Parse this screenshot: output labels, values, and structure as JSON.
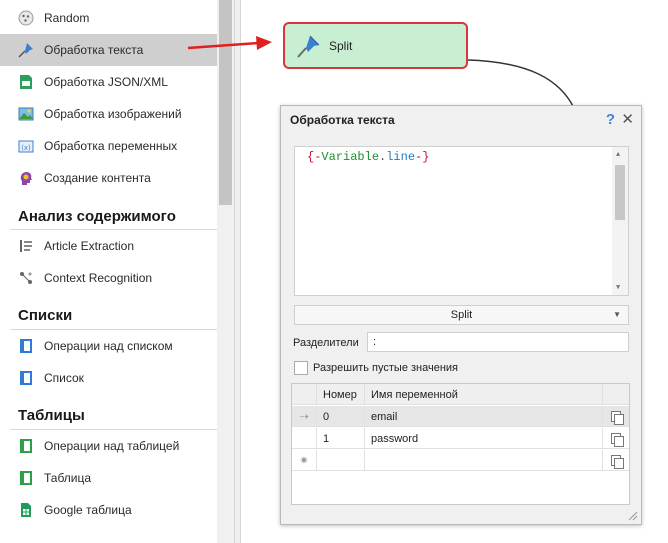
{
  "sidebar": {
    "items": [
      {
        "label": "Random",
        "icon": "dice-icon"
      },
      {
        "label": "Обработка текста",
        "icon": "pin-icon",
        "selected": true
      },
      {
        "label": "Обработка JSON/XML",
        "icon": "json-file-icon"
      },
      {
        "label": "Обработка изображений",
        "icon": "image-icon"
      },
      {
        "label": "Обработка переменных",
        "icon": "variable-icon"
      },
      {
        "label": "Создание контента",
        "icon": "head-bulb-icon"
      }
    ],
    "sections": [
      {
        "title": "Анализ содержимого",
        "items": [
          {
            "label": "Article Extraction",
            "icon": "article-icon"
          },
          {
            "label": "Context Recognition",
            "icon": "context-icon"
          }
        ]
      },
      {
        "title": "Списки",
        "items": [
          {
            "label": "Операции над списком",
            "icon": "list-ops-icon"
          },
          {
            "label": "Список",
            "icon": "list-icon"
          }
        ]
      },
      {
        "title": "Таблицы",
        "items": [
          {
            "label": "Операции над таблицей",
            "icon": "table-ops-icon"
          },
          {
            "label": "Таблица",
            "icon": "table-icon"
          },
          {
            "label": "Google таблица",
            "icon": "google-sheets-icon"
          }
        ]
      }
    ]
  },
  "node": {
    "label": "Split",
    "icon": "pin-icon"
  },
  "dialog": {
    "title": "Обработка текста",
    "help": "?",
    "close": "✕",
    "editor": {
      "open": "{-",
      "var": "Variable",
      "dot": ".",
      "prop": "line",
      "close": "-}"
    },
    "operation": "Split",
    "separator_label": "Разделители",
    "separator_value": ":",
    "allow_empty_label": "Разрешить пустые значения",
    "allow_empty_checked": false,
    "grid": {
      "columns": [
        "Номер",
        "Имя переменной"
      ],
      "rows": [
        {
          "num": "0",
          "name": "email"
        },
        {
          "num": "1",
          "name": "password"
        },
        {
          "num": "",
          "name": ""
        }
      ]
    }
  },
  "colors": {
    "node_bg": "#c9efd2",
    "node_border": "#d4373d",
    "arrow": "#e02020",
    "selected_item": "#cfcfcf"
  }
}
